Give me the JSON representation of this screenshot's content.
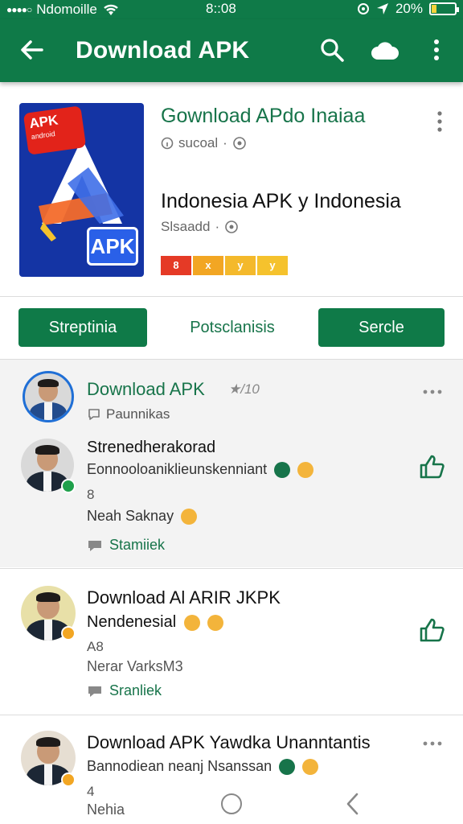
{
  "status_bar": {
    "carrier": "Ndomoille",
    "time": "8::08",
    "battery": "20%",
    "battery_level": 0.2
  },
  "app_bar": {
    "title": "Download APK",
    "back_icon": "arrow-left-icon",
    "search_icon": "search-icon",
    "cloud_icon": "cloud-icon",
    "more_icon": "more-vert-icon"
  },
  "app_header": {
    "name": "Gownload APdo Inaiaa",
    "meta1": "sucoal",
    "subtitle": "Indonesia APK y Indonesia",
    "meta2": "Slsaadd",
    "icon_badge": "APK",
    "icon_badge_small": "android",
    "icon_label": "APK",
    "chips": [
      {
        "label": "8",
        "color": "#e53a26"
      },
      {
        "label": "x",
        "color": "#f2a623"
      },
      {
        "label": "y",
        "color": "#f4b92b"
      },
      {
        "label": "y",
        "color": "#f5c22d"
      }
    ]
  },
  "actions": {
    "left": "Streptinia",
    "middle": "Potsclanisis",
    "right": "Sercle"
  },
  "reviews": [
    {
      "header_title": "Download APK",
      "header_suffix": "★/10",
      "header_sub": "Paunnikas",
      "name": "Strenedherakorad",
      "text": "Eonnooloaniklieunskenniant",
      "count": "8",
      "date": "Neah Saknay",
      "reply": "Stamiiek"
    },
    {
      "name": "Download Al ARIR JKPK",
      "text": "Nendenesial",
      "count": "A8",
      "date": "Nerar VarksM3",
      "reply": "Sranliek"
    },
    {
      "name": "Download APK Yawdka Unanntantis",
      "text": "Bannodiean neanj Nsanssan",
      "count": "4",
      "date": "Nehia"
    }
  ]
}
